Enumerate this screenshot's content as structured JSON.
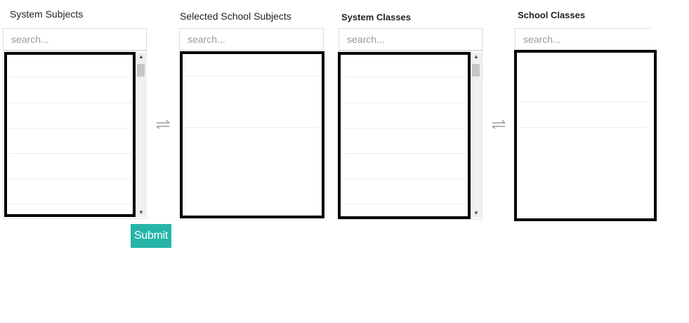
{
  "system_subjects": {
    "title": "System Subjects",
    "search_placeholder": "search..."
  },
  "selected_school_subjects": {
    "title": "Selected School Subjects",
    "search_placeholder": "search..."
  },
  "system_classes": {
    "title": "System Classes",
    "search_placeholder": "search..."
  },
  "school_classes": {
    "title": "School Classes",
    "search_placeholder": "search..."
  },
  "icons": {
    "transfer": "double-arrow-transfer-icon",
    "scroll_up": "arrow-up-icon",
    "scroll_down": "arrow-down-icon"
  },
  "submit": {
    "label": "Submit"
  },
  "colors": {
    "submit_bg": "#26b5a9",
    "redaction_border": "#000000"
  }
}
